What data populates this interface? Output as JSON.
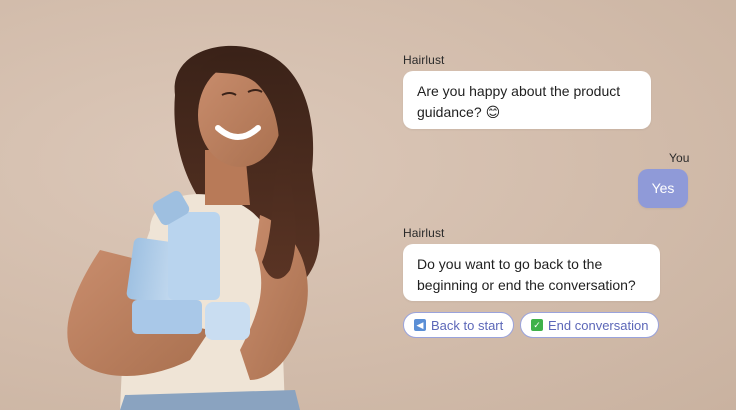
{
  "chat": {
    "messages": [
      {
        "sender": "Hairlust",
        "text_line1": "Are you happy about the product",
        "text_line2": "guidance?",
        "emoji": "😊"
      },
      {
        "sender": "You",
        "text": "Yes"
      },
      {
        "sender": "Hairlust",
        "text_line1": "Do you want to go back to the",
        "text_line2": "beginning or end the conversation?"
      }
    ],
    "options": [
      {
        "label": "Back to start",
        "icon": "back-arrow-icon"
      },
      {
        "label": "End conversation",
        "icon": "check-mark-icon"
      }
    ]
  },
  "colors": {
    "background": "#d4bfae",
    "bubble_bot": "#ffffff",
    "bubble_user": "#8f9ad8",
    "chip_border": "#9aa3dc",
    "chip_text": "#5c67b8"
  }
}
